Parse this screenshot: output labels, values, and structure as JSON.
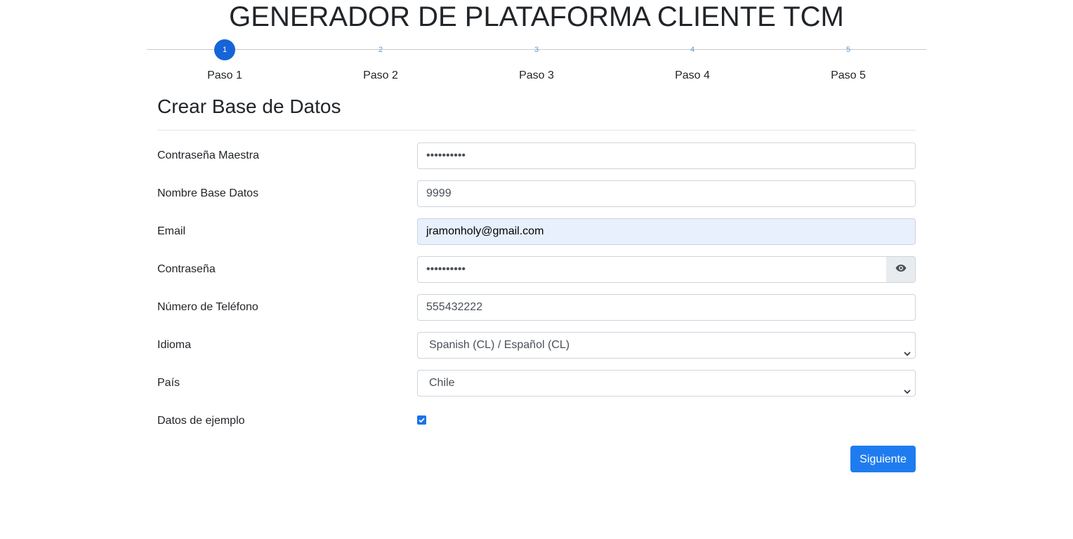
{
  "header": {
    "title": "GENERADOR DE PLATAFORMA CLIENTE TCM"
  },
  "stepper": {
    "active_step": 1,
    "steps": [
      {
        "number": "1",
        "label": "Paso 1"
      },
      {
        "number": "2",
        "label": "Paso 2"
      },
      {
        "number": "3",
        "label": "Paso 3"
      },
      {
        "number": "4",
        "label": "Paso 4"
      },
      {
        "number": "5",
        "label": "Paso 5"
      }
    ]
  },
  "form": {
    "title": "Crear Base de Datos",
    "master_password": {
      "label": "Contraseña Maestra",
      "value": "••••••••••"
    },
    "db_name": {
      "label": "Nombre Base Datos",
      "value": "9999"
    },
    "email": {
      "label": "Email",
      "value": "jramonholy@gmail.com"
    },
    "password": {
      "label": "Contraseña",
      "value": "••••••••••",
      "toggle_icon": "eye-icon"
    },
    "phone": {
      "label": "Número de Teléfono",
      "value": "555432222"
    },
    "language": {
      "label": "Idioma",
      "value": "Spanish (CL) / Español (CL)"
    },
    "country": {
      "label": "País",
      "value": "Chile"
    },
    "demo_data": {
      "label": "Datos de ejemplo",
      "checked": true
    },
    "next_button": "Siguiente"
  },
  "colors": {
    "primary": "#1f7cf0",
    "step_active": "#1565d8",
    "step_inactive_text": "#5b9bd5",
    "autofill_bg": "#e8f0fe"
  }
}
